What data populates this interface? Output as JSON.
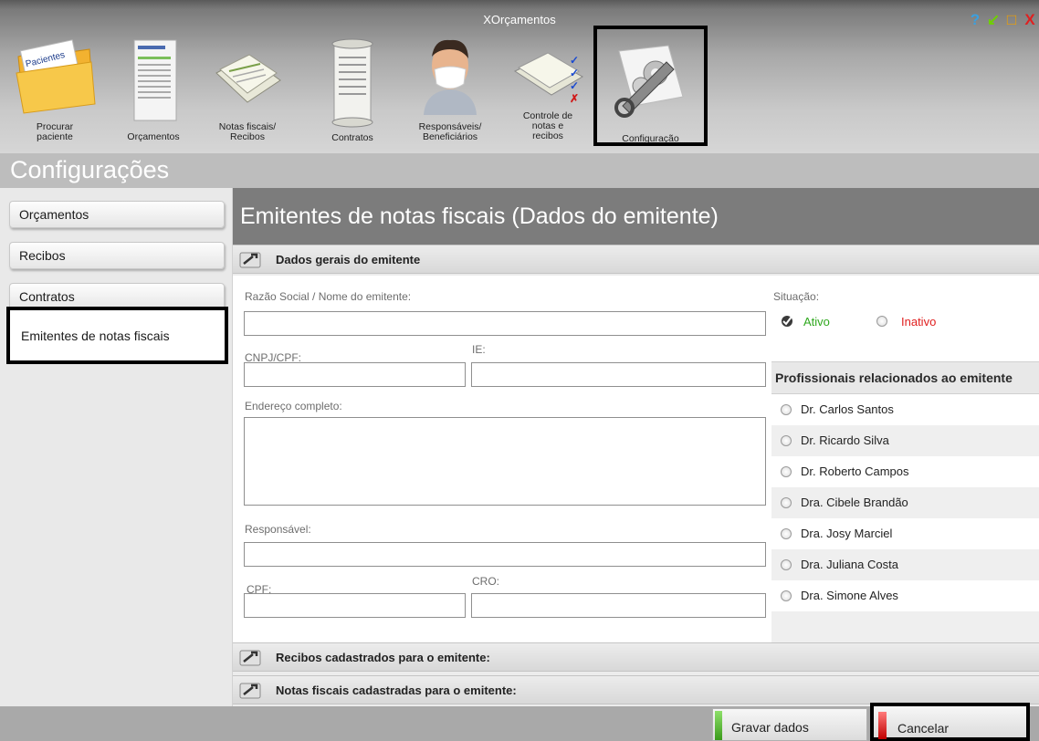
{
  "app_title": "XOrçamentos",
  "window_controls": [
    {
      "icon": "help-icon",
      "glyph": "?",
      "color": "#3aa0e0"
    },
    {
      "icon": "minimize-icon",
      "glyph": "↙",
      "color": "#6fd000"
    },
    {
      "icon": "maximize-icon",
      "glyph": "□",
      "color": "#f0a000"
    },
    {
      "icon": "close-icon",
      "glyph": "X",
      "color": "#e02020"
    }
  ],
  "toolbar": {
    "procurar_paciente": {
      "label_line1": "Procurar",
      "label_line2": "paciente",
      "icon_text": "Pacientes"
    },
    "orcamentos": {
      "label": "Orçamentos"
    },
    "notas_fiscais": {
      "label_line1": "Notas fiscais/",
      "label_line2": "Recibos"
    },
    "contratos": {
      "label": "Contratos"
    },
    "responsaveis": {
      "label_line1": "Responsáveis/",
      "label_line2": "Beneficiários"
    },
    "controle": {
      "label_line1": "Controle de",
      "label_line2": "notas e",
      "label_line3": "recibos"
    },
    "configuracao": {
      "label": "Configuração"
    }
  },
  "section_title": "Configurações",
  "left_nav": {
    "items": [
      "Orçamentos",
      "Recibos",
      "Contratos"
    ],
    "active": "Emitentes de notas fiscais"
  },
  "main": {
    "header": "Emitentes de notas fiscais  (Dados do emitente)",
    "sections": {
      "dados_gerais": "Dados gerais do emitente",
      "recibos": "Recibos cadastrados para o emitente:",
      "notas": "Notas fiscais cadastradas para o emitente:"
    },
    "form": {
      "razao_social_label": "Razão Social / Nome do emitente:",
      "razao_social_value": "",
      "cnpj_label": "CNPJ/CPF:",
      "cnpj_value": "",
      "ie_label": "IE:",
      "ie_value": "",
      "endereco_label": "Endereço completo:",
      "endereco_value": "",
      "responsavel_label": "Responsável:",
      "responsavel_value": "",
      "cpf_label": "CPF:",
      "cpf_value": "",
      "cro_label": "CRO:",
      "cro_value": ""
    },
    "situacao": {
      "label": "Situação:",
      "ativo": "Ativo",
      "inativo": "Inativo",
      "selected": "Ativo",
      "ativo_color": "#2fa81e",
      "inativo_color": "#e02020"
    },
    "profissionais": {
      "header": "Profissionais relacionados ao emitente",
      "items": [
        "Dr. Carlos Santos",
        "Dr. Ricardo Silva",
        "Dr. Roberto Campos",
        "Dra. Cibele Brandão",
        "Dra. Josy Marciel",
        "Dra. Juliana Costa",
        "Dra. Simone Alves"
      ]
    }
  },
  "footer": {
    "save_label": "Gravar dados",
    "cancel_label": "Cancelar"
  }
}
